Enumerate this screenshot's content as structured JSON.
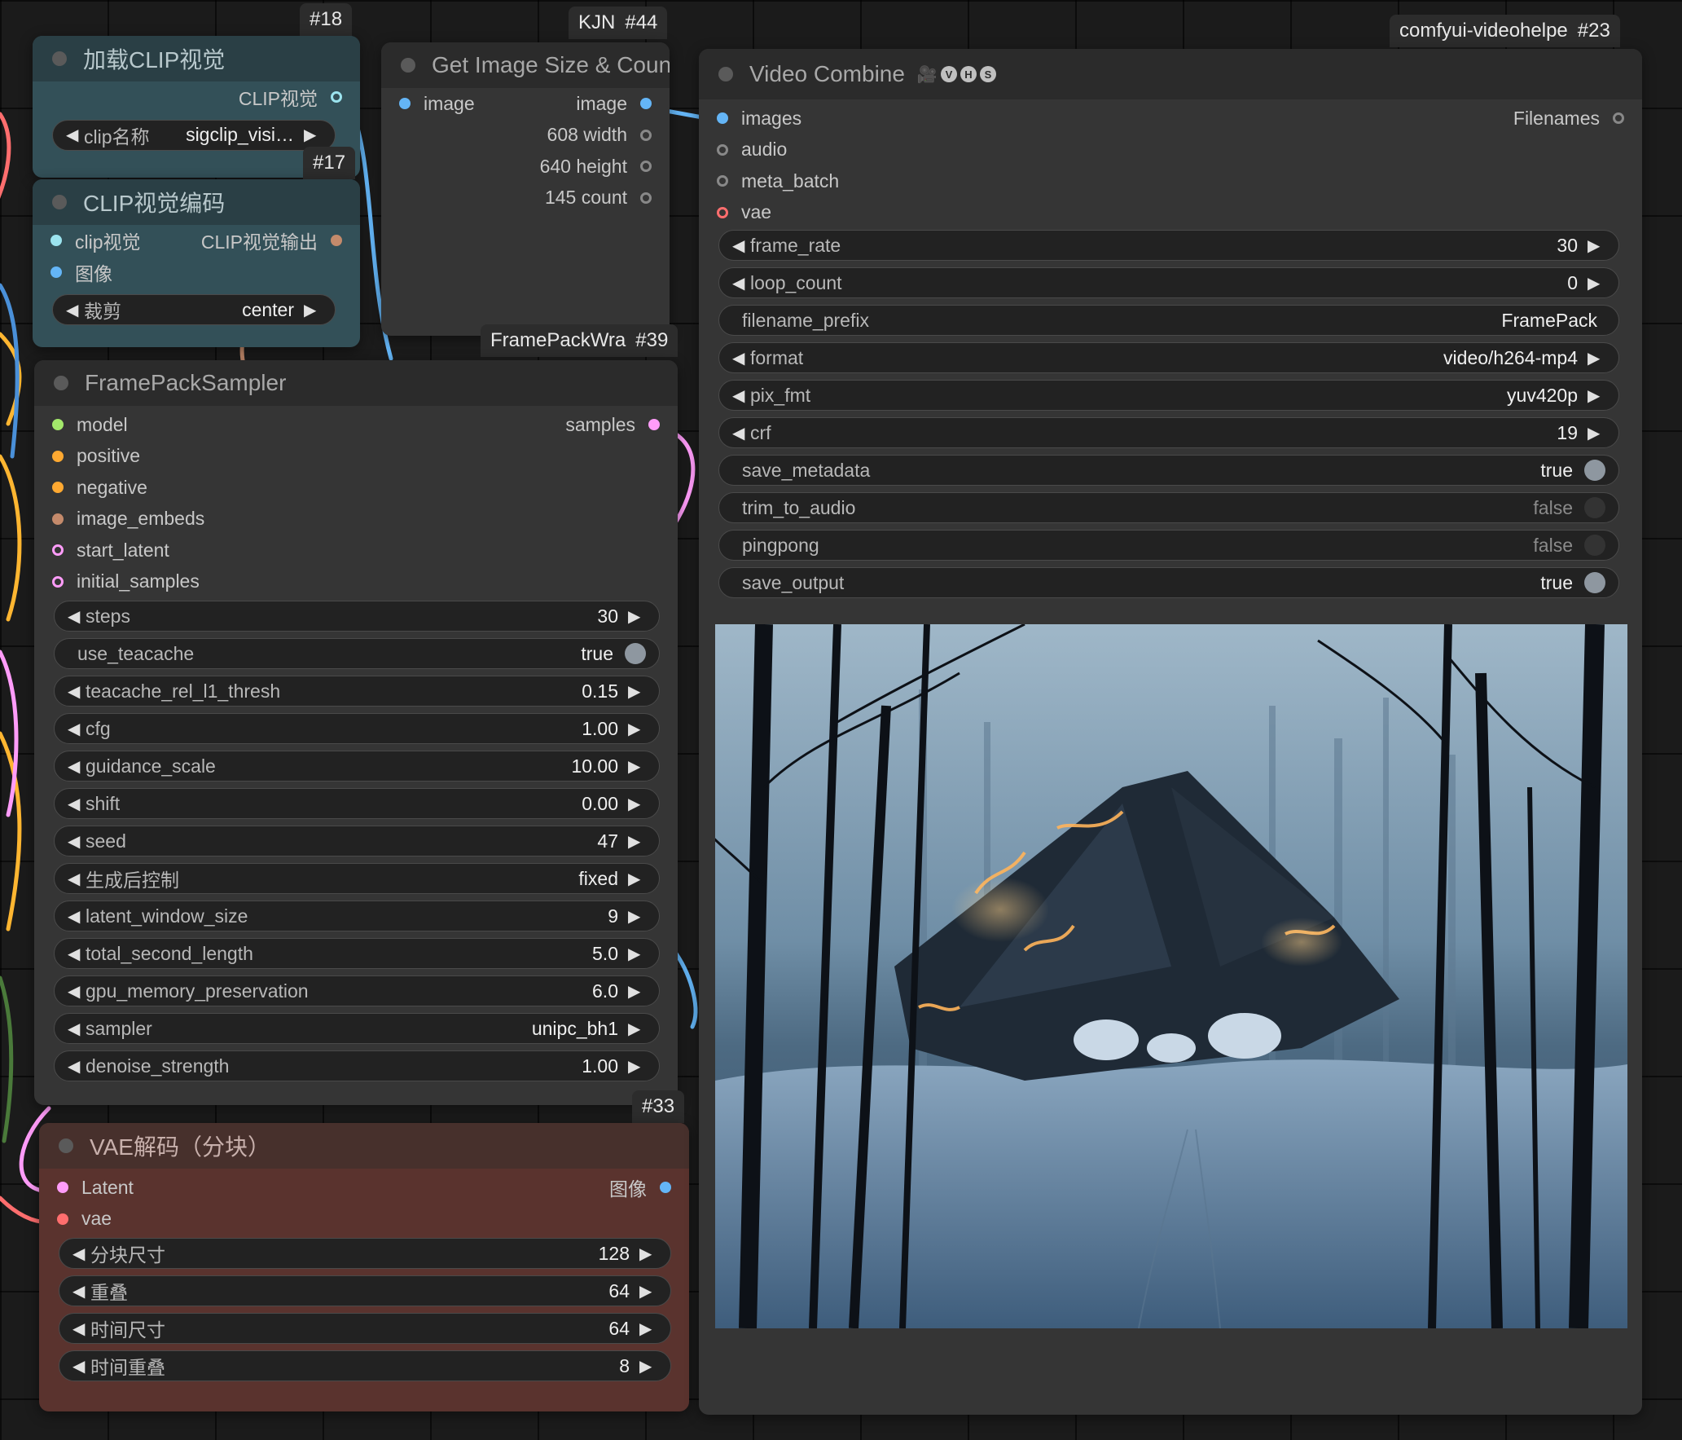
{
  "colors": {
    "canvas": "#1b1b1b",
    "node_body": "#353535",
    "node_title": "#2b2b2b",
    "clip_node_body": "#335058",
    "clip_node_title": "#2a3f45",
    "vae_node_body": "#5a332e",
    "vae_node_title": "#47302c",
    "socket_clip_vision": "#9be3ee",
    "socket_image": "#64b5f6",
    "socket_model": "#a3e86b",
    "socket_conditioning": "#ffa931",
    "socket_embeds": "#c48a6b",
    "socket_latent": "#ff9cf9",
    "socket_vae": "#ff6e6e",
    "socket_int": "#888888"
  },
  "badges": {
    "clip_loader": {
      "num": "#18"
    },
    "clip_encode": {
      "num": "#17"
    },
    "image_size": {
      "src": "KJN",
      "num": "#44"
    },
    "sampler": {
      "src": "FramePackWra",
      "num": "#39"
    },
    "video_combine": {
      "src": "comfyui-videohelpe",
      "num": "#23"
    },
    "vae_decode": {
      "num": "#33"
    }
  },
  "nodes": {
    "clip_loader": {
      "title": "加载CLIP视觉",
      "output": "CLIP视觉",
      "widget": {
        "label": "clip名称",
        "value": "sigclip_visi…"
      }
    },
    "clip_encode": {
      "title": "CLIP视觉编码",
      "inputs": [
        "clip视觉",
        "图像"
      ],
      "output": "CLIP视觉输出",
      "widget": {
        "label": "裁剪",
        "value": "center"
      }
    },
    "image_size": {
      "title": "Get Image Size & Count",
      "input": "image",
      "outputs": [
        "image",
        "608 width",
        "640 height",
        "145 count"
      ]
    },
    "sampler": {
      "title": "FramePackSampler",
      "inputs": [
        "model",
        "positive",
        "negative",
        "image_embeds",
        "start_latent",
        "initial_samples"
      ],
      "output": "samples",
      "widgets": [
        {
          "label": "steps",
          "value": "30"
        },
        {
          "label": "use_teacache",
          "value": "true"
        },
        {
          "label": "teacache_rel_l1_thresh",
          "value": "0.15"
        },
        {
          "label": "cfg",
          "value": "1.00"
        },
        {
          "label": "guidance_scale",
          "value": "10.00"
        },
        {
          "label": "shift",
          "value": "0.00"
        },
        {
          "label": "seed",
          "value": "47"
        },
        {
          "label": "生成后控制",
          "value": "fixed"
        },
        {
          "label": "latent_window_size",
          "value": "9"
        },
        {
          "label": "total_second_length",
          "value": "5.0"
        },
        {
          "label": "gpu_memory_preservation",
          "value": "6.0"
        },
        {
          "label": "sampler",
          "value": "unipc_bh1"
        },
        {
          "label": "denoise_strength",
          "value": "1.00"
        }
      ]
    },
    "vae_decode": {
      "title": "VAE解码（分块）",
      "inputs": [
        "Latent",
        "vae"
      ],
      "output": "图像",
      "widgets": [
        {
          "label": "分块尺寸",
          "value": "128"
        },
        {
          "label": "重叠",
          "value": "64"
        },
        {
          "label": "时间尺寸",
          "value": "64"
        },
        {
          "label": "时间重叠",
          "value": "8"
        }
      ]
    },
    "video_combine": {
      "title": "Video Combine",
      "title_icons": [
        "🎥",
        "V",
        "H",
        "S"
      ],
      "inputs": [
        "images",
        "audio",
        "meta_batch",
        "vae"
      ],
      "output": "Filenames",
      "widgets": [
        {
          "label": "frame_rate",
          "value": "30"
        },
        {
          "label": "loop_count",
          "value": "0"
        },
        {
          "label": "filename_prefix",
          "value": "FramePack"
        },
        {
          "label": "format",
          "value": "video/h264-mp4"
        },
        {
          "label": "pix_fmt",
          "value": "yuv420p"
        },
        {
          "label": "crf",
          "value": "19"
        },
        {
          "label": "save_metadata",
          "value": "true"
        },
        {
          "label": "trim_to_audio",
          "value": "false"
        },
        {
          "label": "pingpong",
          "value": "false"
        },
        {
          "label": "save_output",
          "value": "true"
        }
      ]
    }
  }
}
